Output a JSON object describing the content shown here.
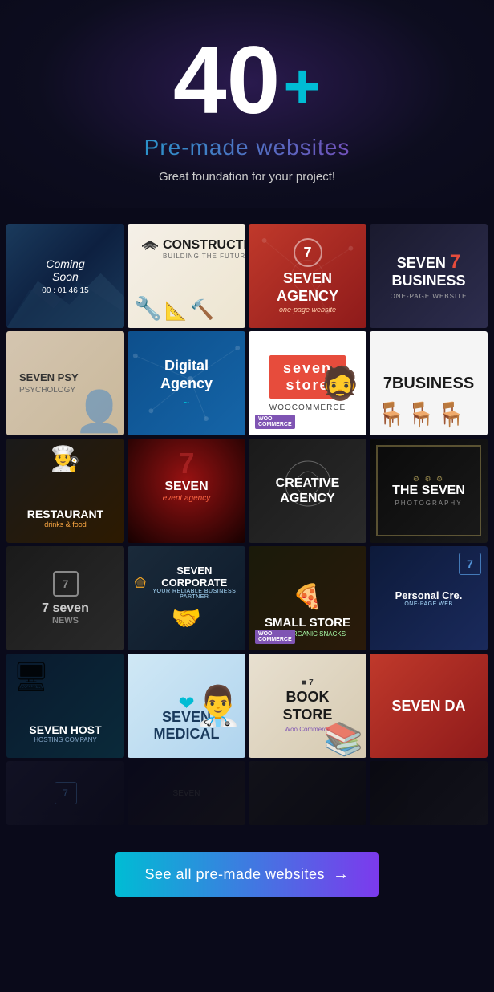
{
  "hero": {
    "number": "40",
    "plus": "+",
    "subtitle": "Pre-made websites",
    "description": "Great foundation for your project!"
  },
  "cta": {
    "label": "See all pre-made websites",
    "arrow": "→"
  },
  "grid": {
    "rows": [
      [
        {
          "id": "coming-soon",
          "label": "Coming Soon",
          "sublabel": "00 : 01  46  15",
          "style": "coming-soon"
        },
        {
          "id": "construction",
          "label": "CONSTRUCTION",
          "sublabel": "BUILDING THE FUTURE",
          "style": "construction"
        },
        {
          "id": "seven-agency",
          "label": "SEVEN AGENCY",
          "sublabel": "one-page website",
          "style": "seven-agency"
        },
        {
          "id": "seven-business",
          "label": "SEVEN 7 BUSINESS",
          "sublabel": "ONE-PAGE WEBSITE",
          "style": "seven-business"
        }
      ],
      [
        {
          "id": "seven-psy",
          "label": "SEVEN PSY",
          "sublabel": "PSYCHOLOGY",
          "style": "seven-psy"
        },
        {
          "id": "digital-agency",
          "label": "Digital Agency",
          "sublabel": "",
          "style": "digital-agency"
        },
        {
          "id": "seven-store",
          "label": "seven store",
          "sublabel": "WooCommerce",
          "style": "seven-store"
        },
        {
          "id": "7business",
          "label": "7BUSINESS",
          "sublabel": "",
          "style": "7business"
        }
      ],
      [
        {
          "id": "restaurant",
          "label": "RESTAURANT",
          "sublabel": "drinks & food",
          "style": "restaurant"
        },
        {
          "id": "seven-event",
          "label": "SEVEN",
          "sublabel": "event agency",
          "style": "seven-event"
        },
        {
          "id": "creative-agency",
          "label": "CREATIVE AGENCY",
          "sublabel": "",
          "style": "creative-agency"
        },
        {
          "id": "the-seven",
          "label": "THE SEVEN",
          "sublabel": "PHOTOGRAPHY",
          "style": "the-seven"
        }
      ],
      [
        {
          "id": "small-tea",
          "label": "7 seven NEWS",
          "sublabel": "",
          "style": "small-tea"
        },
        {
          "id": "seven-corporate",
          "label": "SEVEN CORPORATE",
          "sublabel": "YOUR RELIABLE BUSINESS PARTNER",
          "style": "seven-corporate"
        },
        {
          "id": "small-store",
          "label": "SMALL STORE",
          "sublabel": "100% ORGANIC SNACKS",
          "style": "small-store"
        },
        {
          "id": "personal-cre",
          "label": "Personal Cre.",
          "sublabel": "ONE-PAGE WEB",
          "style": "personal-cre"
        }
      ],
      [
        {
          "id": "seven-host",
          "label": "SEVEN HOST",
          "sublabel": "HOSTING COMPANY",
          "style": "seven-host"
        },
        {
          "id": "seven-medical",
          "label": "SEVEN MEDICAL",
          "sublabel": "",
          "style": "seven-medical"
        },
        {
          "id": "book-store",
          "label": "BOOK STORE",
          "sublabel": "WooCommerce",
          "style": "book-store"
        },
        {
          "id": "seven-da",
          "label": "SEVEN DA",
          "sublabel": "",
          "style": "seven-da"
        }
      ],
      [
        {
          "id": "extra1",
          "label": "",
          "sublabel": "",
          "style": "extra1"
        },
        {
          "id": "extra2",
          "label": "",
          "sublabel": "",
          "style": "extra2"
        },
        {
          "id": "extra3",
          "label": "",
          "sublabel": "",
          "style": "extra3"
        },
        {
          "id": "extra4",
          "label": "",
          "sublabel": "",
          "style": "extra4"
        }
      ]
    ]
  }
}
